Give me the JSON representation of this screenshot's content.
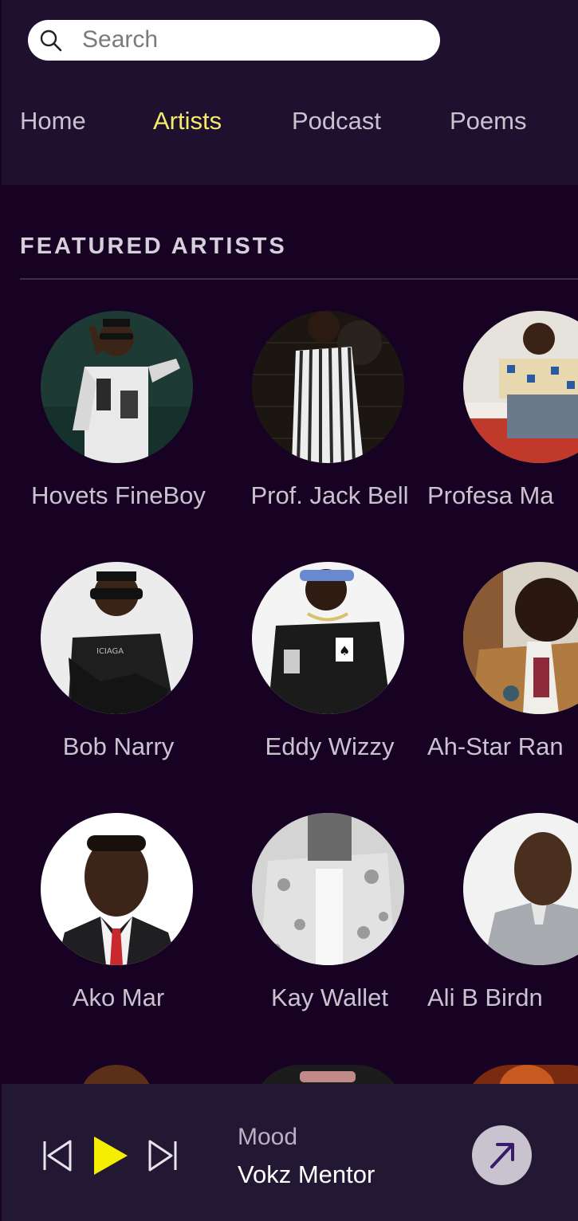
{
  "search": {
    "placeholder": "Search",
    "value": "",
    "icon": "search-icon"
  },
  "tabs": [
    {
      "label": "Home",
      "active": false
    },
    {
      "label": "Artists",
      "active": true
    },
    {
      "label": "Podcast",
      "active": false
    },
    {
      "label": "Poems",
      "active": false
    }
  ],
  "featured": {
    "title": "FEATURED ARTISTS",
    "artists": [
      {
        "name": "Hovets FineBoy"
      },
      {
        "name": "Prof. Jack Bell"
      },
      {
        "name": "Profesa Ma"
      },
      {
        "name": "Bob Narry"
      },
      {
        "name": "Eddy Wizzy"
      },
      {
        "name": "Ah-Star Ran"
      },
      {
        "name": "Ako Mar"
      },
      {
        "name": "Kay Wallet"
      },
      {
        "name": "Ali B Birdn"
      }
    ]
  },
  "player": {
    "track_title": "Mood",
    "track_artist": "Vokz Mentor",
    "state": "paused"
  },
  "colors": {
    "background": "#170223",
    "header": "#1f1030",
    "player_bar": "#231834",
    "active_tab": "#f2ea6a",
    "play_button": "#f5ee00",
    "text": "#c9c3cf"
  }
}
